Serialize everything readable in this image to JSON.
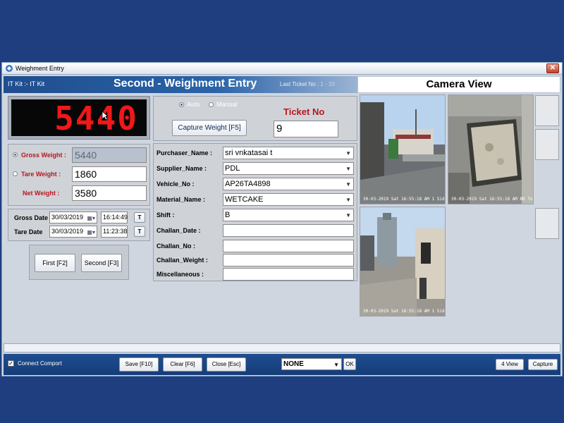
{
  "window": {
    "title": "Weighment Entry",
    "close_label": "✕"
  },
  "header": {
    "company": "IT Kit :- IT Kit",
    "title": "Second - Weighment Entry",
    "last_ticket_label": "Last Ticket No :",
    "last_ticket_value": "1 - 33"
  },
  "camera": {
    "title": "Camera View",
    "feeds": [
      {
        "stamp": "30-03-2019 Sat 16:55:18 AM   1 Side View"
      },
      {
        "stamp": "30-03-2019 Sat 16:55:18 AM   ND Top View"
      },
      {
        "stamp": "30-03-2019 Sat 16:55:18 AM   1 Side View"
      }
    ]
  },
  "display": {
    "reading": "5440"
  },
  "capture": {
    "mode_auto": "Auto",
    "mode_manual": "Manual",
    "selected_mode": "auto",
    "capture_button": "Capture Weight [F5]",
    "ticket_label": "Ticket No",
    "ticket_value": "9"
  },
  "weights": {
    "gross_label": "Gross Weight :",
    "gross_value": "5440",
    "tare_label": "Tare Weight   :",
    "tare_value": "1860",
    "net_label": "Net Weight :",
    "net_value": "3580",
    "selected": "gross"
  },
  "dates": {
    "gross_label": "Gross Date",
    "gross_date": "30/03/2019",
    "gross_time": "16:14:49",
    "tare_label": "Tare Date",
    "tare_date": "30/03/2019",
    "tare_time": "11:23:38",
    "t_button": "T"
  },
  "weigh_buttons": {
    "first": "First [F2]",
    "second": "Second [F3]"
  },
  "form": {
    "purchaser_label": "Purchaser_Name :",
    "purchaser_value": "sri vnkatasai t",
    "supplier_label": "Supplier_Name :",
    "supplier_value": "PDL",
    "vehicle_label": "Vehicle_No :",
    "vehicle_value": "AP26TA4898",
    "material_label": "Material_Name :",
    "material_value": "WETCAKE",
    "shift_label": "Shift :",
    "shift_value": "B",
    "challan_date_label": "Challan_Date :",
    "challan_date_value": "",
    "challan_no_label": "Challan_No :",
    "challan_no_value": "",
    "challan_weight_label": "Challan_Weight :",
    "challan_weight_value": "",
    "misc_label": "Miscellaneous :",
    "misc_value": ""
  },
  "bottom": {
    "connect_label": "Connect Comport",
    "connect_checked": true,
    "save": "Save [F10]",
    "clear": "Clear [F6]",
    "close": "Close [Esc]",
    "select_value": "NONE",
    "ok": "OK",
    "four_view": "4 View",
    "capture": "Capture"
  },
  "colors": {
    "accent_red": "#b8161e",
    "header_blue": "#1f4d8f",
    "display_red": "#f01818"
  }
}
